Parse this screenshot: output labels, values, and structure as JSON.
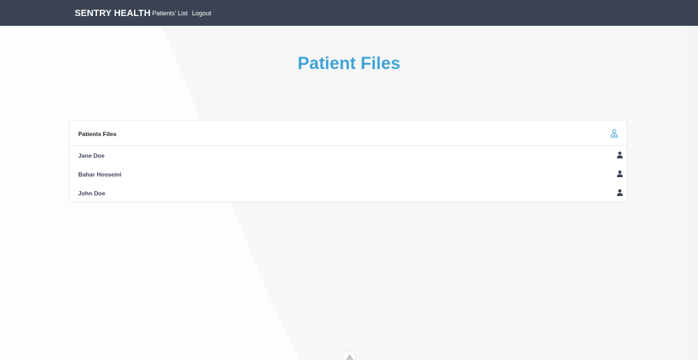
{
  "navbar": {
    "brand": "SENTRY HEALTH",
    "links": [
      {
        "label": "Patients' List"
      },
      {
        "label": "Logout"
      }
    ]
  },
  "page": {
    "title": "Patient Files"
  },
  "panel": {
    "title": "Patients Files",
    "add_icon": "add-user-icon",
    "patients": [
      {
        "name": "Jane Doe",
        "icon": "user-icon"
      },
      {
        "name": "Bahar Hosseini",
        "icon": "user-icon"
      },
      {
        "name": "John Doe",
        "icon": "user-icon"
      }
    ]
  },
  "footer": {
    "logo_icon": "sentry-logo-icon"
  },
  "colors": {
    "navbar_bg": "#3b4454",
    "title_accent": "#3ea3d8",
    "patient_text": "#3b4454"
  }
}
